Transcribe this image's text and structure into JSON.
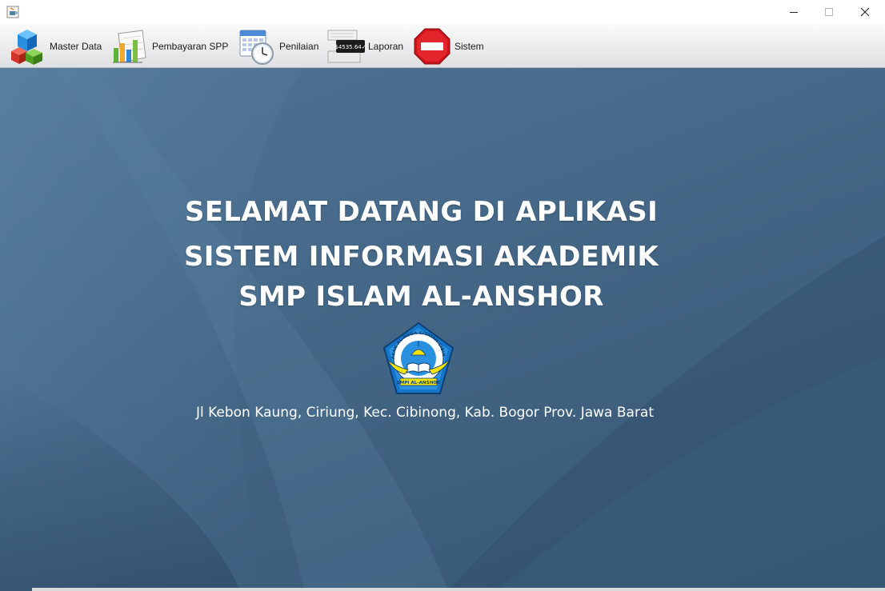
{
  "window": {
    "app_icon": "java-cup-icon",
    "controls": {
      "minimize": "minimize-icon",
      "maximize": "maximize-icon",
      "close": "close-icon"
    }
  },
  "toolbar": {
    "items": [
      {
        "label": "Master Data",
        "icon": "cubes-icon"
      },
      {
        "label": "Pembayaran SPP",
        "icon": "bar-chart-icon"
      },
      {
        "label": "Penilaian",
        "icon": "calendar-clock-icon"
      },
      {
        "label": "Laporan",
        "icon": "calculator-display-icon",
        "display_text": "$4535.64✓"
      },
      {
        "label": "Sistem",
        "icon": "stop-sign-icon"
      }
    ]
  },
  "main": {
    "title_line1": "SELAMAT DATANG DI APLIKASI",
    "title_line2": "SISTEM INFORMASI AKADEMIK",
    "title_line3": "SMP ISLAM AL-ANSHOR",
    "logo": {
      "ring_text": "YAYASAN AL-HUDA CITATAH CIBINONG",
      "banner_text": "SMPI AL-ANSHOR"
    },
    "address": "Jl Kebon Kaung, Ciriung, Kec. Cibinong, Kab. Bogor Prov. Jawa Barat"
  },
  "colors": {
    "background": "#476a8a",
    "toolbar": "#eeeeef",
    "title_text": "#ffffff"
  }
}
